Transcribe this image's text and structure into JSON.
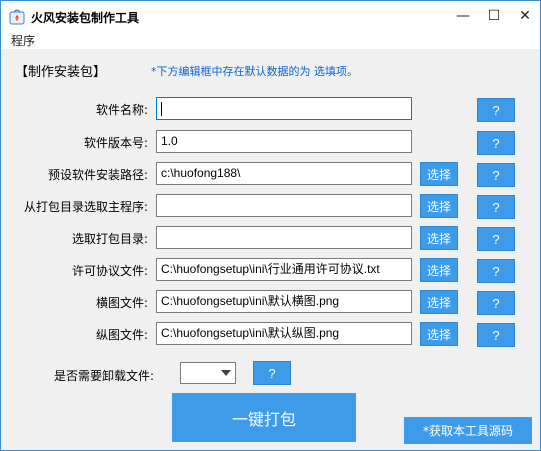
{
  "window": {
    "title": "火风安装包制作工具",
    "minimize_glyph": "—",
    "maximize_glyph": "☐",
    "close_glyph": "✕",
    "icon": "app-icon",
    "accent_color": "#3d9be9"
  },
  "menu": {
    "items": [
      {
        "label": "程序"
      }
    ]
  },
  "section": {
    "title": "【制作安装包】",
    "hint": "*下方编辑框中存在默认数据的为 选填项。"
  },
  "rows": [
    {
      "label": "软件名称:",
      "value": "",
      "select_label": "",
      "help_label": "?"
    },
    {
      "label": "软件版本号:",
      "value": "1.0",
      "select_label": "",
      "help_label": "?"
    },
    {
      "label": "预设软件安装路径:",
      "value": "c:\\huofong188\\",
      "select_label": "选择",
      "help_label": "?"
    },
    {
      "label": "从打包目录选取主程序:",
      "value": "",
      "select_label": "选择",
      "help_label": "?"
    },
    {
      "label": "选取打包目录:",
      "value": "",
      "select_label": "选择",
      "help_label": "?"
    },
    {
      "label": "许可协议文件:",
      "value": "C:\\huofongsetup\\ini\\行业通用许可协议.txt",
      "select_label": "选择",
      "help_label": "?"
    },
    {
      "label": "横图文件:",
      "value": "C:\\huofongsetup\\ini\\默认横图.png",
      "select_label": "选择",
      "help_label": "?"
    },
    {
      "label": "纵图文件:",
      "value": "C:\\huofongsetup\\ini\\默认纵图.png",
      "select_label": "选择",
      "help_label": "?"
    }
  ],
  "uninstall": {
    "label": "是否需要卸载文件:",
    "selected": "",
    "help_label": "?"
  },
  "actions": {
    "pack_label": "一键打包",
    "source_label": "*获取本工具源码"
  }
}
